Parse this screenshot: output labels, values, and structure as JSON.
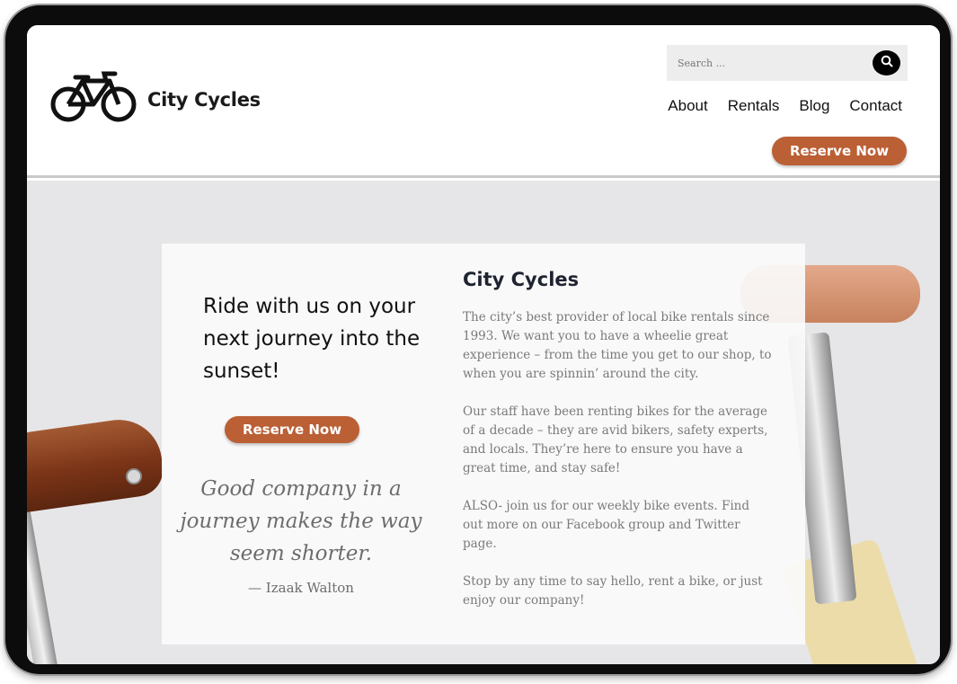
{
  "header": {
    "brand": "City Cycles",
    "search": {
      "placeholder": "Search ..."
    },
    "nav": [
      "About",
      "Rentals",
      "Blog",
      "Contact"
    ],
    "cta": "Reserve Now"
  },
  "hero": {
    "tagline": "Ride with us on your next journey into the sunset!",
    "cta": "Reserve Now",
    "quote": "Good company in a journey makes the way seem shorter.",
    "quote_author": "— Izaak Walton",
    "title": "City Cycles",
    "paragraphs": [
      "The city’s best provider of local bike rentals since 1993. We want you to have a wheelie great experience – from the time you get to our shop, to when you are spinnin’ around the city.",
      "Our staff have been renting bikes for the average of a decade – they are avid bikers, safety experts, and locals. They’re here to ensure you have a great time, and stay safe!",
      "ALSO- join us for our weekly bike events. Find out more on our Facebook group and Twitter page.",
      "Stop by any time to say hello, rent a bike, or just enjoy our company!"
    ]
  },
  "colors": {
    "accent": "#bb5f35",
    "frame": "#0c0c0c",
    "hero_bg": "#e6e6e8"
  },
  "icons": [
    "bicycle-logo-icon",
    "search-icon"
  ]
}
